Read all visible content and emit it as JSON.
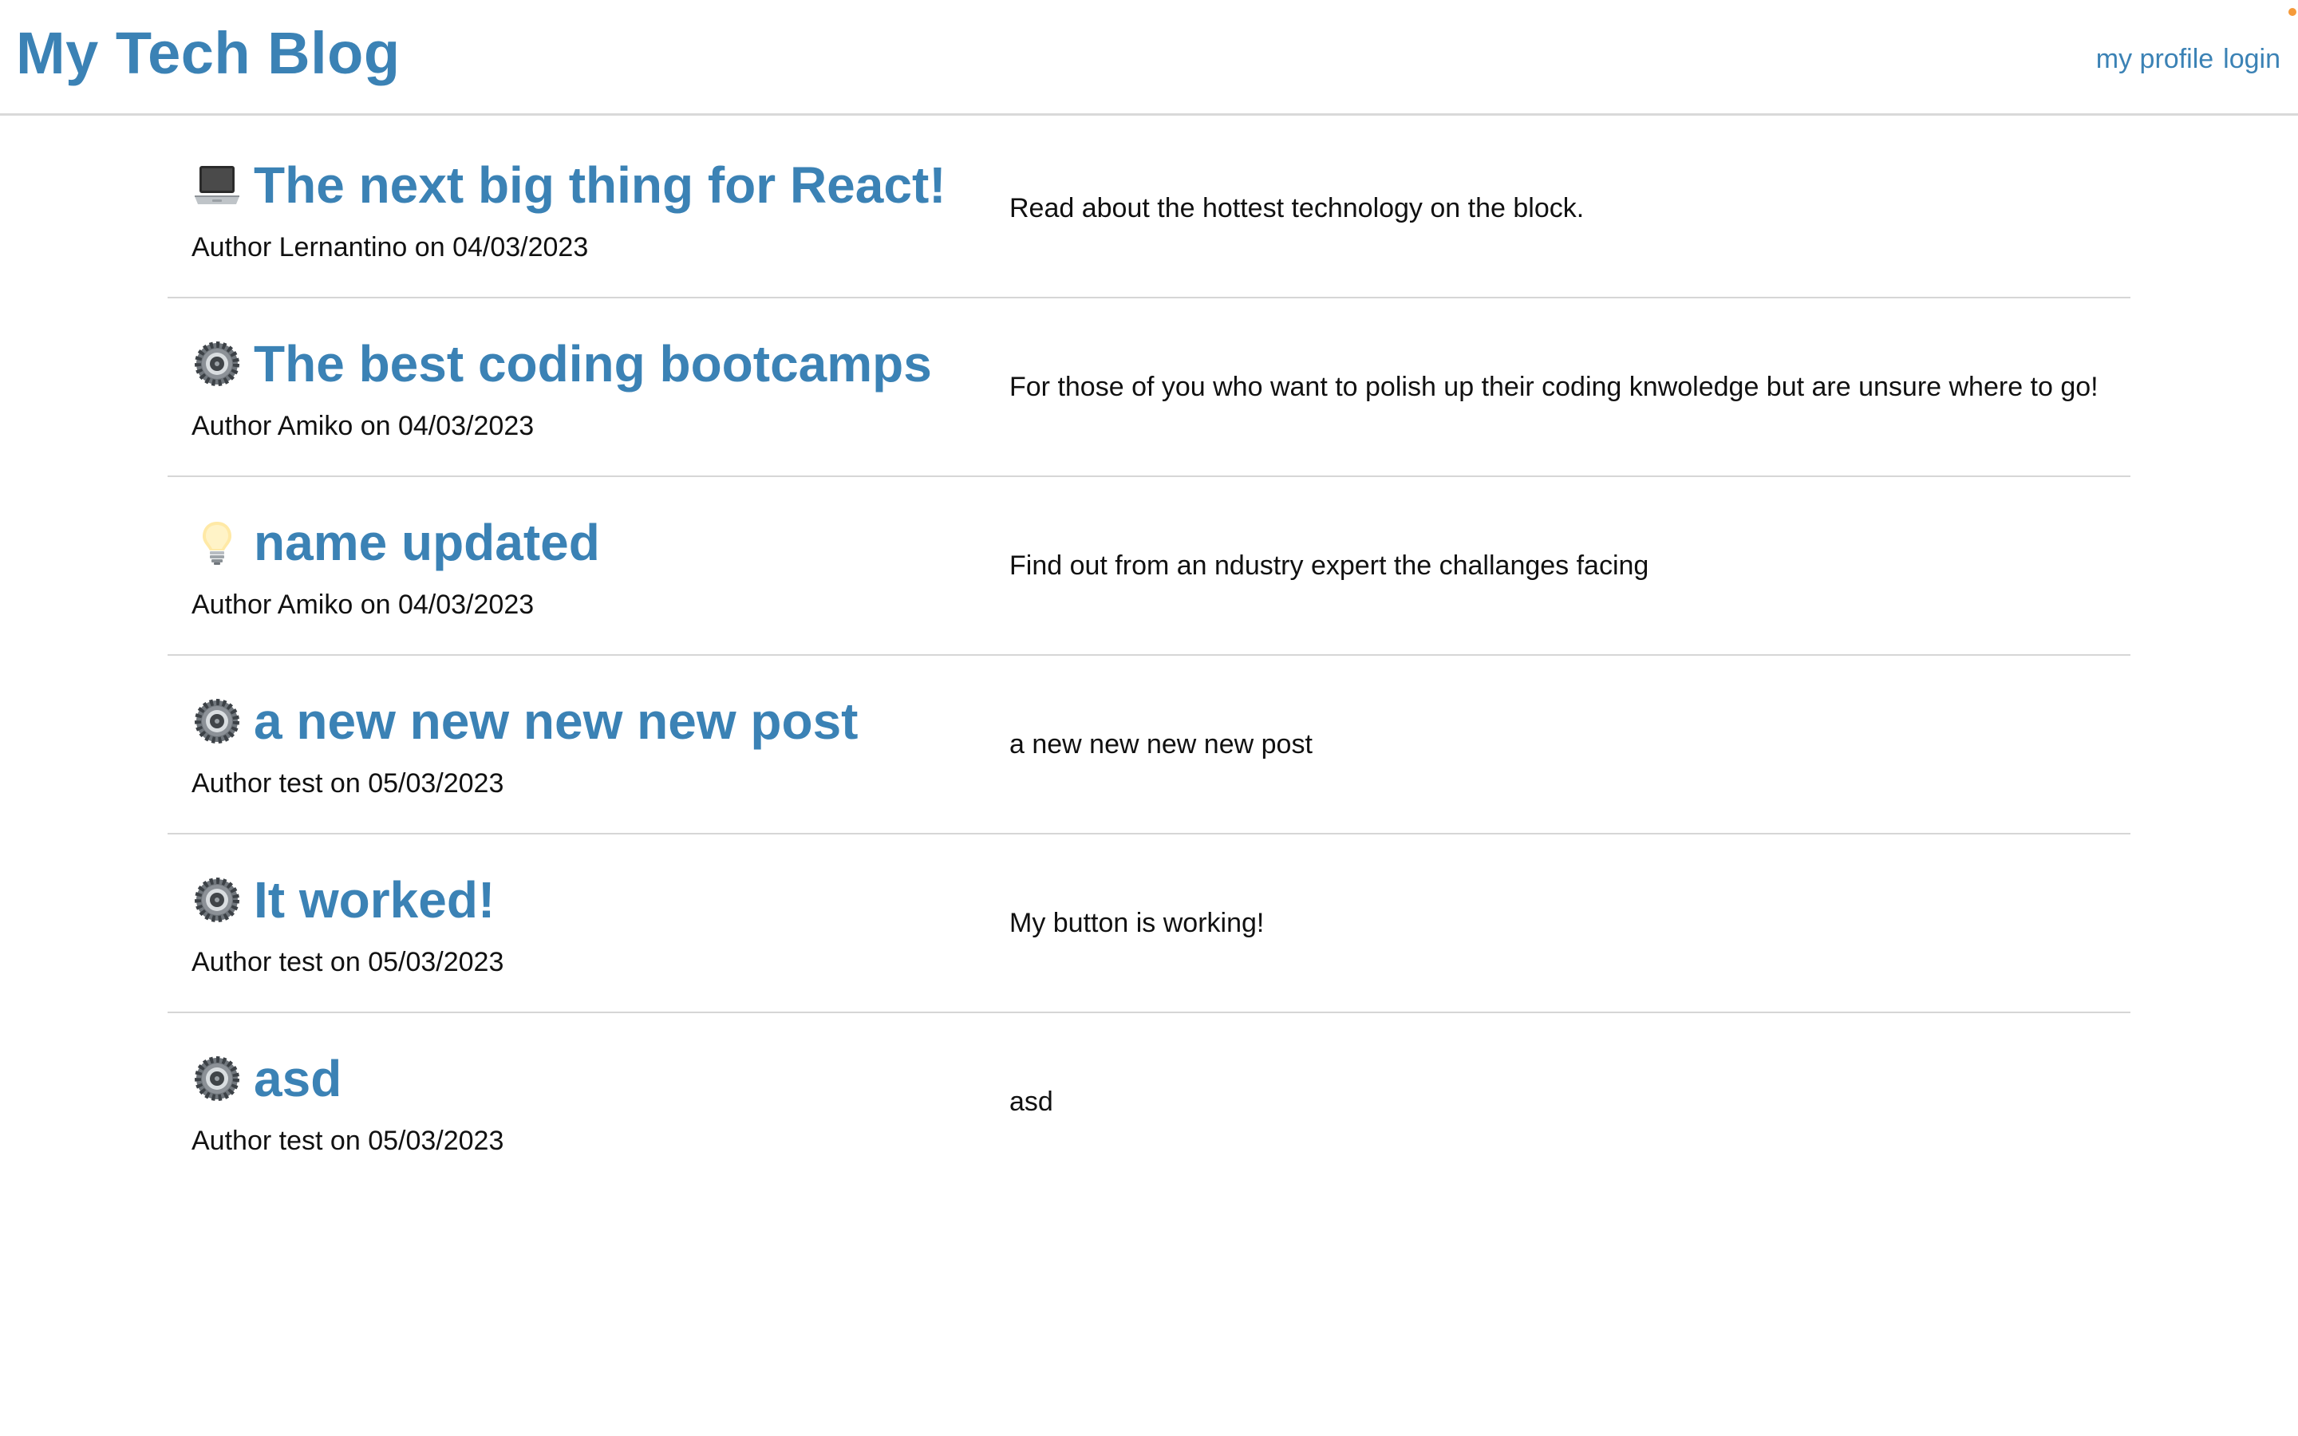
{
  "header": {
    "title": "My Tech Blog",
    "nav": {
      "profile_label": "my profile",
      "login_label": "login"
    }
  },
  "colors": {
    "accent": "#3b82b5",
    "divider": "#d6d6d6",
    "status_dot": "#f59a3a"
  },
  "posts": [
    {
      "icon": "laptop-icon",
      "title": "The next big thing for React!",
      "author_prefix": "Author",
      "author": "Lernantino",
      "on": "on",
      "date": "04/03/2023",
      "description": "Read about the hottest technology on the block."
    },
    {
      "icon": "gear-icon",
      "title": "The best coding bootcamps",
      "author_prefix": "Author",
      "author": "Amiko",
      "on": "on",
      "date": "04/03/2023",
      "description": "For those of you who want to polish up their coding knwoledge but are unsure where to go!"
    },
    {
      "icon": "lightbulb-icon",
      "title": "name updated",
      "author_prefix": "Author",
      "author": "Amiko",
      "on": "on",
      "date": "04/03/2023",
      "description": "Find out from an ndustry expert the challanges facing"
    },
    {
      "icon": "gear-icon",
      "title": "a new new new new post",
      "author_prefix": "Author",
      "author": "test",
      "on": "on",
      "date": "05/03/2023",
      "description": "a new new new new post"
    },
    {
      "icon": "gear-icon",
      "title": "It worked!",
      "author_prefix": "Author",
      "author": "test",
      "on": "on",
      "date": "05/03/2023",
      "description": "My button is working!"
    },
    {
      "icon": "gear-icon",
      "title": "asd",
      "author_prefix": "Author",
      "author": "test",
      "on": "on",
      "date": "05/03/2023",
      "description": "asd"
    }
  ]
}
